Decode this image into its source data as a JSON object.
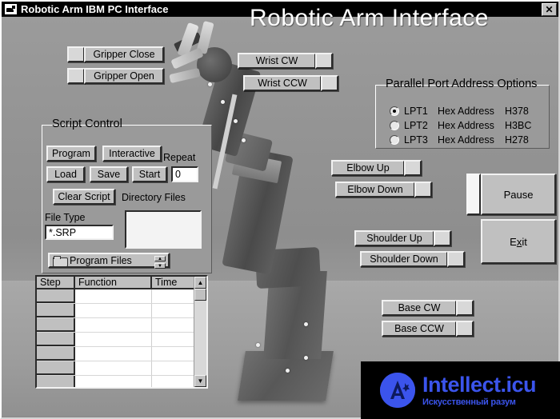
{
  "window": {
    "title": "Robotic Arm IBM PC Interface",
    "close_label": "✕",
    "icon": "app-icon"
  },
  "heading": "Robotic Arm Interface",
  "gripper": {
    "close_label": "Gripper Close",
    "open_label": "Gripper Open"
  },
  "wrist": {
    "cw_label": "Wrist CW",
    "ccw_label": "Wrist CCW"
  },
  "elbow": {
    "up_label": "Elbow Up",
    "down_label": "Elbow Down"
  },
  "shoulder": {
    "up_label": "Shoulder Up",
    "down_label": "Shoulder Down"
  },
  "base": {
    "cw_label": "Base CW",
    "ccw_label": "Base CCW"
  },
  "actions": {
    "pause_label": "Pause",
    "exit_label_before": "E",
    "exit_label_accel": "x",
    "exit_label_after": "it"
  },
  "parallel_port": {
    "group_title": "Parallel Port Address Options",
    "options": [
      {
        "label": "LPT1",
        "hex_caption": "Hex Address",
        "hex_value": "H378",
        "selected": true
      },
      {
        "label": "LPT2",
        "hex_caption": "Hex  Address",
        "hex_value": "H3BC",
        "selected": false
      },
      {
        "label": "LPT3",
        "hex_caption": "Hex Address",
        "hex_value": "H278",
        "selected": false
      }
    ]
  },
  "script_control": {
    "group_title": "Script Control",
    "program_label": "Program",
    "interactive_label": "Interactive",
    "load_label": "Load",
    "save_label": "Save",
    "start_label": "Start",
    "repeat_label": "Repeat",
    "repeat_value": "0",
    "clear_script_label": "Clear Script",
    "directory_files_label": "Directory Files",
    "file_type_label": "File Type",
    "file_type_value": "*.SRP",
    "directory_files_items": [],
    "folder_combo_value": "Program Files"
  },
  "script_grid": {
    "columns": [
      "Step",
      "Function",
      "Time"
    ],
    "rows": [
      {
        "step": "",
        "function": "",
        "time": ""
      },
      {
        "step": "",
        "function": "",
        "time": ""
      },
      {
        "step": "",
        "function": "",
        "time": ""
      },
      {
        "step": "",
        "function": "",
        "time": ""
      },
      {
        "step": "",
        "function": "",
        "time": ""
      },
      {
        "step": "",
        "function": "",
        "time": ""
      },
      {
        "step": "",
        "function": "",
        "time": ""
      }
    ],
    "scroll_up": "▲",
    "scroll_down": "▼"
  },
  "watermark": {
    "main": "Intellect.icu",
    "sub": "Искусственный разум",
    "badge_letter": "A"
  },
  "colors": {
    "titlebar_bg": "#000000",
    "titlebar_fg": "#ffffff",
    "face": "#c0c0c0",
    "window_bg": "#8a8a8a",
    "watermark_blue": "#3b54ec"
  }
}
